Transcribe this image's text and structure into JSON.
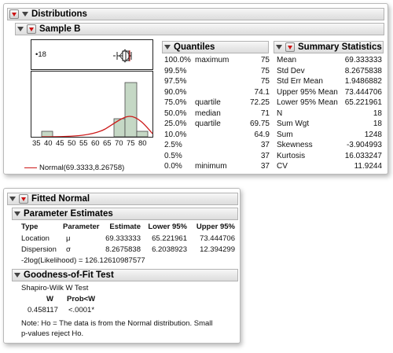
{
  "distributions": {
    "title": "Distributions",
    "sample": {
      "title": "Sample B",
      "outlier_label": "•18",
      "axis_ticks": [
        "35",
        "40",
        "45",
        "50",
        "55",
        "60",
        "65",
        "70",
        "75",
        "80"
      ],
      "legend": "Normal(69.3333,8.26758)",
      "curve_color": "#cc1a1a",
      "bar_color": "#c5d8c5"
    },
    "quantiles": {
      "title": "Quantiles",
      "rows": [
        {
          "pct": "100.0%",
          "label": "maximum",
          "value": "75"
        },
        {
          "pct": "99.5%",
          "label": "",
          "value": "75"
        },
        {
          "pct": "97.5%",
          "label": "",
          "value": "75"
        },
        {
          "pct": "90.0%",
          "label": "",
          "value": "74.1"
        },
        {
          "pct": "75.0%",
          "label": "quartile",
          "value": "72.25"
        },
        {
          "pct": "50.0%",
          "label": "median",
          "value": "71"
        },
        {
          "pct": "25.0%",
          "label": "quartile",
          "value": "69.75"
        },
        {
          "pct": "10.0%",
          "label": "",
          "value": "64.9"
        },
        {
          "pct": "2.5%",
          "label": "",
          "value": "37"
        },
        {
          "pct": "0.5%",
          "label": "",
          "value": "37"
        },
        {
          "pct": "0.0%",
          "label": "minimum",
          "value": "37"
        }
      ]
    },
    "summary": {
      "title": "Summary Statistics",
      "rows": [
        {
          "label": "Mean",
          "value": "69.333333"
        },
        {
          "label": "Std Dev",
          "value": "8.2675838"
        },
        {
          "label": "Std Err Mean",
          "value": "1.9486882"
        },
        {
          "label": "Upper 95% Mean",
          "value": "73.444706"
        },
        {
          "label": "Lower 95% Mean",
          "value": "65.221961"
        },
        {
          "label": "N",
          "value": "18"
        },
        {
          "label": "Sum Wgt",
          "value": "18"
        },
        {
          "label": "Sum",
          "value": "1248"
        },
        {
          "label": "Skewness",
          "value": "-3.904993"
        },
        {
          "label": "Kurtosis",
          "value": "16.033247"
        },
        {
          "label": "CV",
          "value": "11.9244"
        }
      ]
    }
  },
  "fitted": {
    "title": "Fitted Normal",
    "params": {
      "title": "Parameter Estimates",
      "headers": [
        "Type",
        "Parameter",
        "Estimate",
        "Lower 95%",
        "Upper 95%"
      ],
      "rows": [
        [
          "Location",
          "μ",
          "69.333333",
          "65.221961",
          "73.444706"
        ],
        [
          "Dispersion",
          "σ",
          "8.2675838",
          "6.2038923",
          "12.394299"
        ]
      ],
      "likelihood": "-2log(Likelihood) = 126.12610987577"
    },
    "gof": {
      "title": "Goodness-of-Fit Test",
      "test_name": "Shapiro-Wilk W Test",
      "headers": [
        "W",
        "Prob<W"
      ],
      "values": [
        "0.458117",
        "<.0001*"
      ],
      "note1": "Note: Ho = The data is from the Normal distribution. Small",
      "note2": "p-values reject Ho."
    }
  }
}
